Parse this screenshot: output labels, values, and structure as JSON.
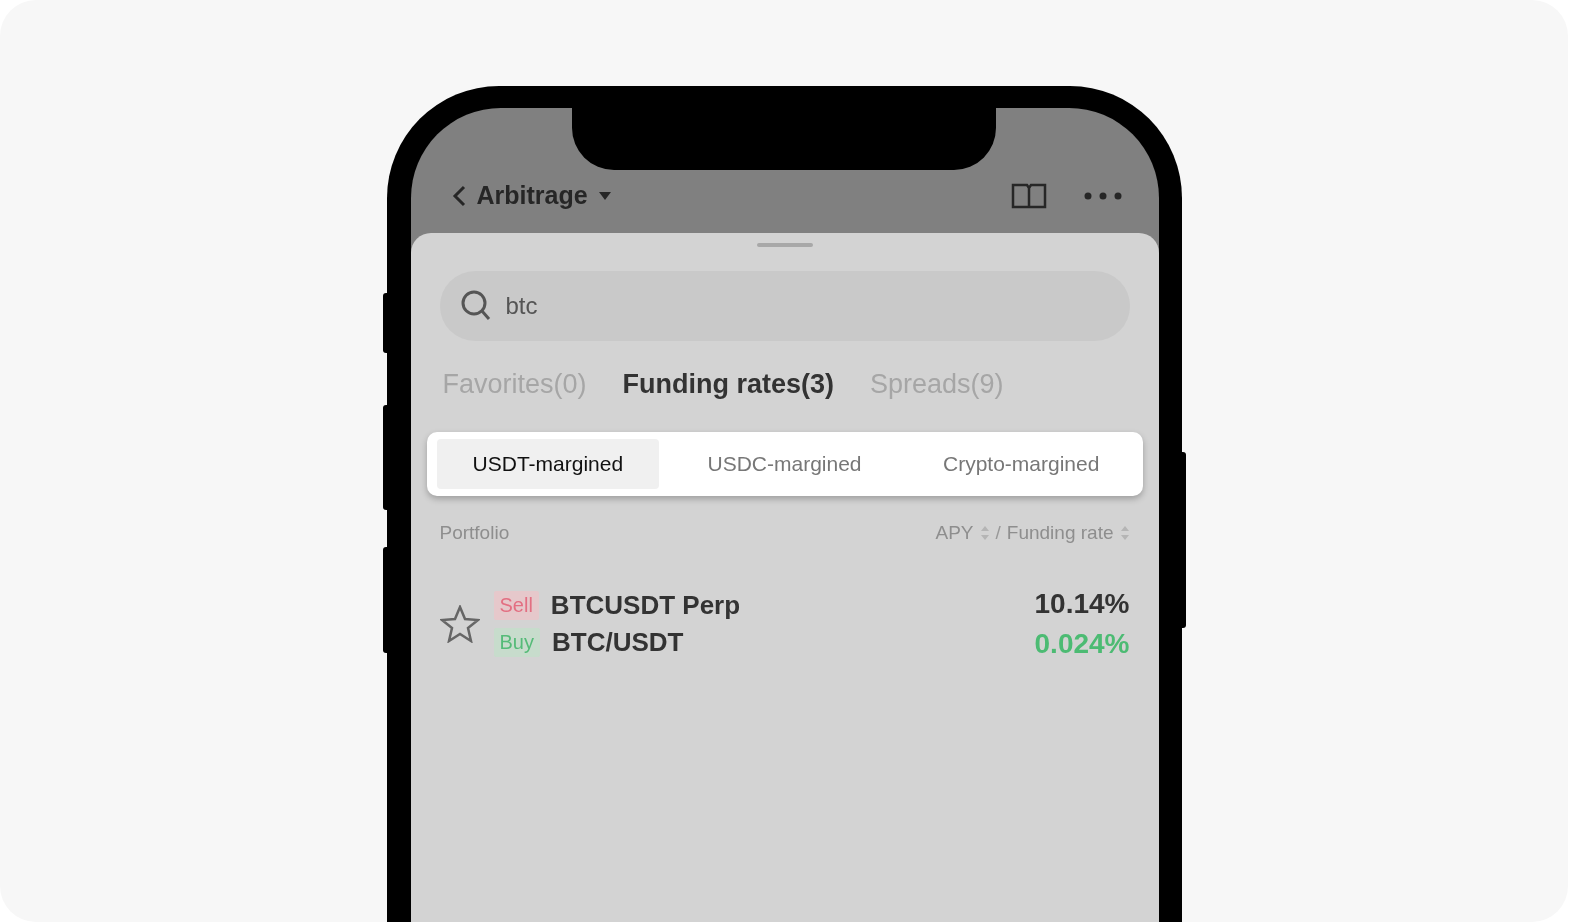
{
  "header": {
    "title": "Arbitrage"
  },
  "search": {
    "value": "btc"
  },
  "tabs": [
    {
      "label": "Favorites(0)",
      "selected": false
    },
    {
      "label": "Funding rates(3)",
      "selected": true
    },
    {
      "label": "Spreads(9)",
      "selected": false
    }
  ],
  "margin_tabs": [
    {
      "label": "USDT-margined",
      "selected": true
    },
    {
      "label": "USDC-margined",
      "selected": false
    },
    {
      "label": "Crypto-margined",
      "selected": false
    }
  ],
  "list_header": {
    "portfolio": "Portfolio",
    "apy": "APY",
    "separator": "/",
    "funding_rate": "Funding rate"
  },
  "rows": [
    {
      "favorite": false,
      "legs": [
        {
          "kind": "sell",
          "side": "Sell",
          "pair": "BTCUSDT Perp"
        },
        {
          "kind": "buy",
          "side": "Buy",
          "pair": "BTC/USDT"
        }
      ],
      "apy": "10.14%",
      "funding_rate": "0.024%"
    }
  ]
}
